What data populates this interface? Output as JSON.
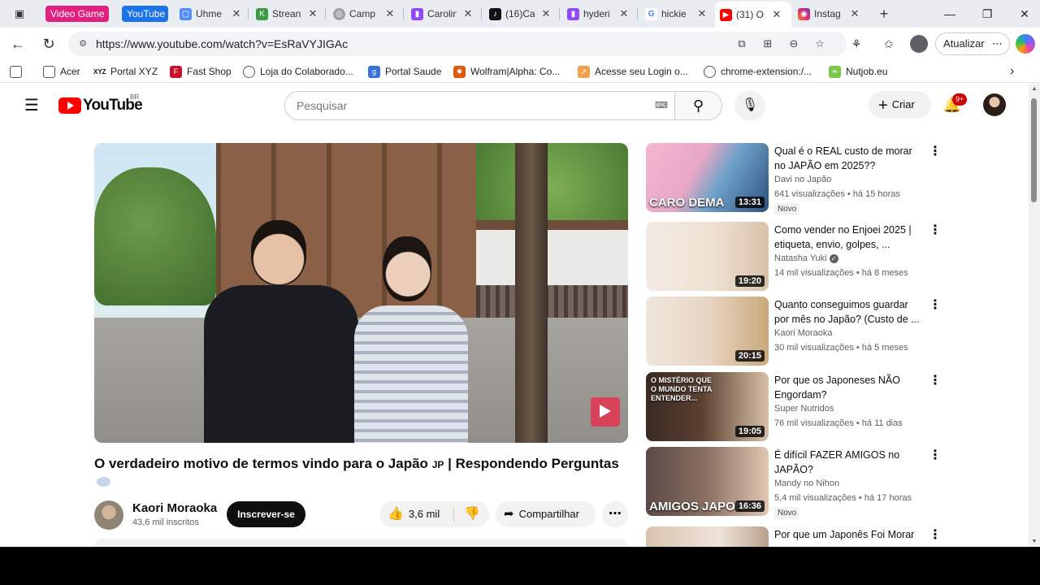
{
  "browser": {
    "tab_groups": [
      {
        "label": "Video Game",
        "color": "#e0217f"
      },
      {
        "label": "YouTube",
        "color": "#1a73e8"
      }
    ],
    "tabs": [
      {
        "title": "Uhme",
        "icon": "chat-icon",
        "color": "#4f8cff"
      },
      {
        "title": "Strean",
        "icon": "k-icon",
        "color": "#3a9a45"
      },
      {
        "title": "Camp",
        "icon": "globe-icon",
        "color": "#888888"
      },
      {
        "title": "Carolin",
        "icon": "twitch-icon",
        "color": "#9146ff"
      },
      {
        "title": "(16)Ca",
        "icon": "tiktok-icon",
        "color": "#111111"
      },
      {
        "title": "hyderi",
        "icon": "twitch-icon",
        "color": "#9146ff"
      },
      {
        "title": "hickie",
        "icon": "google-icon",
        "color": "#4285f4"
      },
      {
        "title": "(31) O",
        "icon": "youtube-icon",
        "color": "#ff0000",
        "active": true
      },
      {
        "title": "Instag",
        "icon": "instagram-icon",
        "color": "#e1306c"
      }
    ],
    "url": "https://www.youtube.com/watch?v=EsRaVYJIGAc",
    "update_label": "Atualizar",
    "bookmarks": [
      {
        "label": "Acer",
        "icon": "folder-icon"
      },
      {
        "label": "Portal XYZ",
        "icon": "xyz-icon"
      },
      {
        "label": "Fast Shop",
        "icon": "fastshop-icon"
      },
      {
        "label": "Loja do Colaborado...",
        "icon": "globe-icon"
      },
      {
        "label": "Portal Saude",
        "icon": "portal-saude-icon"
      },
      {
        "label": "Wolfram|Alpha: Co...",
        "icon": "wolfram-icon"
      },
      {
        "label": "Acesse seu Login o...",
        "icon": "login-icon"
      },
      {
        "label": "chrome-extension:/...",
        "icon": "globe-icon"
      },
      {
        "label": "Nutjob.eu",
        "icon": "leaf-icon"
      }
    ]
  },
  "youtube": {
    "logo_text": "YouTube",
    "country": "BR",
    "search_placeholder": "Pesquisar",
    "create_label": "Criar",
    "notifications_badge": "9+",
    "video": {
      "title": "O verdadeiro motivo de termos vindo para o Japão",
      "title_flag": "JP",
      "title_rest": "| Respondendo Perguntas",
      "channel": "Kaori Moraoka",
      "subscribers": "43,6 mil inscritos",
      "subscribe_label": "Inscrever-se",
      "likes": "3,6 mil",
      "share_label": "Compartilhar"
    },
    "recommendations": [
      {
        "title": "Qual é o REAL custo de morar no JAPÃO em 2025??",
        "channel": "Davi no Japão",
        "views": "641 visualizações",
        "age": "há 15 horas",
        "duration": "13:31",
        "badge": "Novo",
        "overlay": "CARO DEMA",
        "verified": false
      },
      {
        "title": "Como vender no Enjoei 2025 | etiqueta, envio, golpes, ...",
        "channel": "Natasha Yuki",
        "views": "14 mil visualizações",
        "age": "há 8 meses",
        "duration": "19:20",
        "badge": "",
        "overlay": "",
        "verified": true
      },
      {
        "title": "Quanto conseguimos guardar por mês no Japão? (Custo de ...",
        "channel": "Kaori Moraoka",
        "views": "30 mil visualizações",
        "age": "há 5 meses",
        "duration": "20:15",
        "badge": "",
        "overlay": "",
        "verified": false
      },
      {
        "title": "Por que os Japoneses NÃO Engordam?",
        "channel": "Super Nutridos",
        "views": "76 mil visualizações",
        "age": "há 11 dias",
        "duration": "19:05",
        "badge": "",
        "overlay": "O MISTÉRIO QUE O MUNDO TENTA ENTENDER...",
        "verified": false
      },
      {
        "title": "É difícil FAZER AMIGOS  no JAPÃO?",
        "channel": "Mandy no Nihon",
        "views": "5,4 mil visualizações",
        "age": "há 17 horas",
        "duration": "16:36",
        "badge": "Novo",
        "overlay": "AMIGOS JAPON",
        "verified": false
      },
      {
        "title": "Por que um Japonês Foi Morar",
        "channel": "",
        "views": "",
        "age": "",
        "duration": "",
        "badge": "",
        "overlay": "",
        "verified": false
      }
    ]
  }
}
